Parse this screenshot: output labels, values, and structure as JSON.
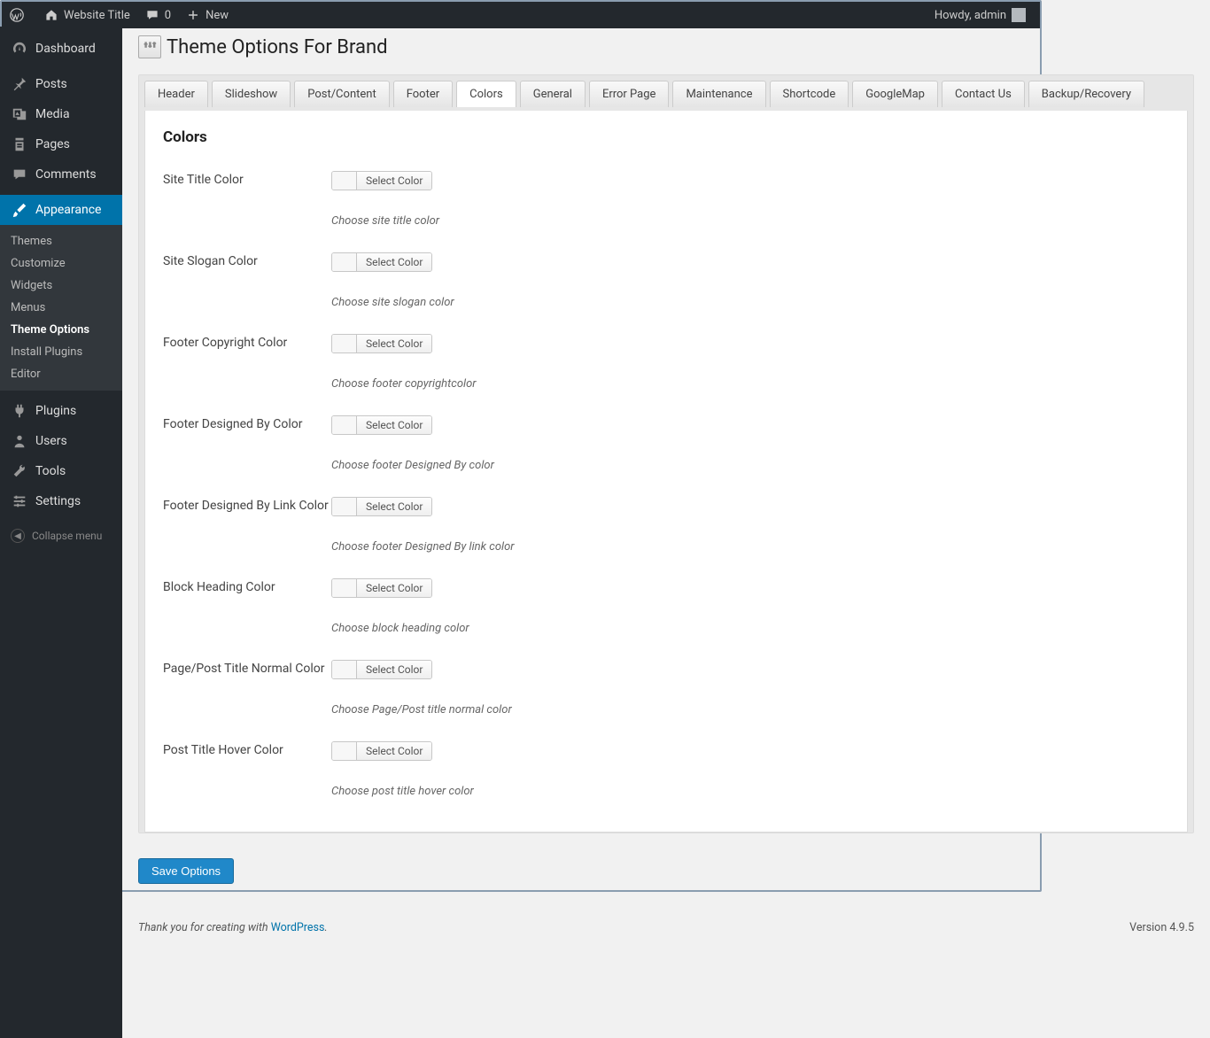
{
  "adminbar": {
    "site_title": "Website Title",
    "comments_count": "0",
    "new_label": "New",
    "howdy": "Howdy, admin"
  },
  "sidebar": {
    "items": [
      {
        "label": "Dashboard",
        "icon": "dash"
      },
      {
        "label": "Posts",
        "icon": "pin"
      },
      {
        "label": "Media",
        "icon": "media"
      },
      {
        "label": "Pages",
        "icon": "pages"
      },
      {
        "label": "Comments",
        "icon": "comment"
      },
      {
        "label": "Appearance",
        "icon": "brush",
        "current": true
      },
      {
        "label": "Plugins",
        "icon": "plug"
      },
      {
        "label": "Users",
        "icon": "user"
      },
      {
        "label": "Tools",
        "icon": "tool"
      },
      {
        "label": "Settings",
        "icon": "settings"
      }
    ],
    "submenu": [
      {
        "label": "Themes"
      },
      {
        "label": "Customize"
      },
      {
        "label": "Widgets"
      },
      {
        "label": "Menus"
      },
      {
        "label": "Theme Options",
        "active": true
      },
      {
        "label": "Install Plugins"
      },
      {
        "label": "Editor"
      }
    ],
    "collapse": "Collapse menu"
  },
  "page": {
    "title": "Theme Options For Brand",
    "tabs": [
      "Header",
      "Slideshow",
      "Post/Content",
      "Footer",
      "Colors",
      "General",
      "Error Page",
      "Maintenance",
      "Shortcode",
      "GoogleMap",
      "Contact Us",
      "Backup/Recovery"
    ],
    "active_tab": "Colors",
    "section_title": "Colors",
    "select_color_label": "Select Color",
    "options": [
      {
        "label": "Site Title Color",
        "desc": "Choose site title color"
      },
      {
        "label": "Site Slogan Color",
        "desc": "Choose site slogan color"
      },
      {
        "label": "Footer Copyright Color",
        "desc": "Choose footer copyrightcolor"
      },
      {
        "label": "Footer Designed By Color",
        "desc": "Choose footer Designed By color"
      },
      {
        "label": "Footer Designed By Link Color",
        "desc": "Choose footer Designed By link color"
      },
      {
        "label": "Block Heading Color",
        "desc": "Choose block heading color"
      },
      {
        "label": "Page/Post Title Normal Color",
        "desc": "Choose Page/Post title normal color"
      },
      {
        "label": "Post Title Hover Color",
        "desc": "Choose post title hover color"
      }
    ],
    "save_label": "Save Options"
  },
  "footer": {
    "thanks": "Thank you for creating with ",
    "wp": "WordPress",
    "period": ".",
    "version": "Version 4.9.5"
  }
}
